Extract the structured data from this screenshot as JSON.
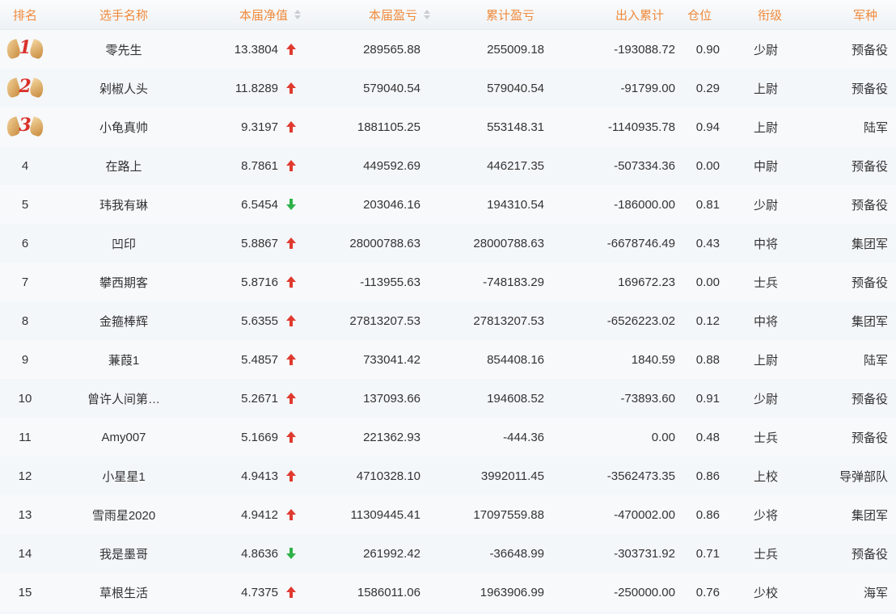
{
  "headers": {
    "rank": "排名",
    "name": "选手名称",
    "net": "本届净值",
    "pnl": "本届盈亏",
    "cum": "累计盈亏",
    "flow": "出入累计",
    "pos": "仓位",
    "rank_title": "衔级",
    "arm": "军种"
  },
  "colors": {
    "header_text": "#f08a3c",
    "up": "#e03a2f",
    "down": "#2fb24a",
    "medal": "#d9312b"
  },
  "rows": [
    {
      "rank": "1",
      "name": "零先生",
      "net": "13.3804",
      "trend": "up",
      "pnl": "289565.88",
      "cum": "255009.18",
      "flow": "-193088.72",
      "pos": "0.90",
      "title": "少尉",
      "arm": "预备役"
    },
    {
      "rank": "2",
      "name": "剁椒人头",
      "net": "11.8289",
      "trend": "up",
      "pnl": "579040.54",
      "cum": "579040.54",
      "flow": "-91799.00",
      "pos": "0.29",
      "title": "上尉",
      "arm": "预备役"
    },
    {
      "rank": "3",
      "name": "小龟真帅",
      "net": "9.3197",
      "trend": "up",
      "pnl": "1881105.25",
      "cum": "553148.31",
      "flow": "-1140935.78",
      "pos": "0.94",
      "title": "上尉",
      "arm": "陆军"
    },
    {
      "rank": "4",
      "name": "在路上",
      "net": "8.7861",
      "trend": "up",
      "pnl": "449592.69",
      "cum": "446217.35",
      "flow": "-507334.36",
      "pos": "0.00",
      "title": "中尉",
      "arm": "预备役"
    },
    {
      "rank": "5",
      "name": "玮我有琳",
      "net": "6.5454",
      "trend": "down",
      "pnl": "203046.16",
      "cum": "194310.54",
      "flow": "-186000.00",
      "pos": "0.81",
      "title": "少尉",
      "arm": "预备役"
    },
    {
      "rank": "6",
      "name": "凹印",
      "net": "5.8867",
      "trend": "up",
      "pnl": "28000788.63",
      "cum": "28000788.63",
      "flow": "-6678746.49",
      "pos": "0.43",
      "title": "中将",
      "arm": "集团军"
    },
    {
      "rank": "7",
      "name": "攀西期客",
      "net": "5.8716",
      "trend": "up",
      "pnl": "-113955.63",
      "cum": "-748183.29",
      "flow": "169672.23",
      "pos": "0.00",
      "title": "士兵",
      "arm": "预备役"
    },
    {
      "rank": "8",
      "name": "金箍棒辉",
      "net": "5.6355",
      "trend": "up",
      "pnl": "27813207.53",
      "cum": "27813207.53",
      "flow": "-6526223.02",
      "pos": "0.12",
      "title": "中将",
      "arm": "集团军"
    },
    {
      "rank": "9",
      "name": "蒹葭1",
      "net": "5.4857",
      "trend": "up",
      "pnl": "733041.42",
      "cum": "854408.16",
      "flow": "1840.59",
      "pos": "0.88",
      "title": "上尉",
      "arm": "陆军"
    },
    {
      "rank": "10",
      "name": "曾许人间第…",
      "net": "5.2671",
      "trend": "up",
      "pnl": "137093.66",
      "cum": "194608.52",
      "flow": "-73893.60",
      "pos": "0.91",
      "title": "少尉",
      "arm": "预备役"
    },
    {
      "rank": "11",
      "name": "Amy007",
      "net": "5.1669",
      "trend": "up",
      "pnl": "221362.93",
      "cum": "-444.36",
      "flow": "0.00",
      "pos": "0.48",
      "title": "士兵",
      "arm": "预备役"
    },
    {
      "rank": "12",
      "name": "小星星1",
      "net": "4.9413",
      "trend": "up",
      "pnl": "4710328.10",
      "cum": "3992011.45",
      "flow": "-3562473.35",
      "pos": "0.86",
      "title": "上校",
      "arm": "导弹部队"
    },
    {
      "rank": "13",
      "name": "雪雨星2020",
      "net": "4.9412",
      "trend": "up",
      "pnl": "11309445.41",
      "cum": "17097559.88",
      "flow": "-470002.00",
      "pos": "0.86",
      "title": "少将",
      "arm": "集团军"
    },
    {
      "rank": "14",
      "name": "我是墨哥",
      "net": "4.8636",
      "trend": "down",
      "pnl": "261992.42",
      "cum": "-36648.99",
      "flow": "-303731.92",
      "pos": "0.71",
      "title": "士兵",
      "arm": "预备役"
    },
    {
      "rank": "15",
      "name": "草根生活",
      "net": "4.7375",
      "trend": "up",
      "pnl": "1586011.06",
      "cum": "1963906.99",
      "flow": "-250000.00",
      "pos": "0.76",
      "title": "少校",
      "arm": "海军"
    }
  ]
}
